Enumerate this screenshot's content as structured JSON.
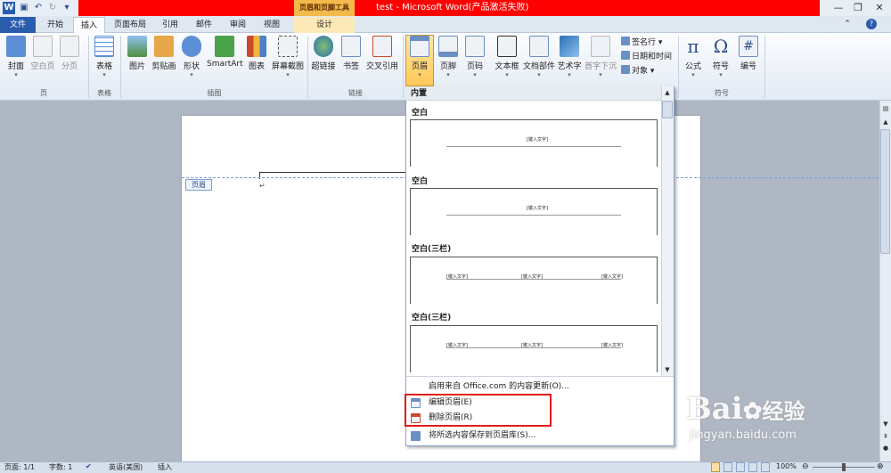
{
  "window": {
    "contextual_group": "页眉和页脚工具",
    "document_title": "test - Microsoft Word(产品激活失败)",
    "controls": [
      "—",
      "❐",
      "✕"
    ],
    "app_icon": "word-icon"
  },
  "tabs": [
    {
      "label": "文件"
    },
    {
      "label": "开始"
    },
    {
      "label": "插入"
    },
    {
      "label": "页面布局"
    },
    {
      "label": "引用"
    },
    {
      "label": "邮件"
    },
    {
      "label": "审阅"
    },
    {
      "label": "视图"
    },
    {
      "label": "设计"
    }
  ],
  "ribbon": {
    "groups": {
      "page": "页",
      "table": "表格",
      "illustrations": "插图",
      "links": "链接",
      "symbols": "符号"
    },
    "buttons": {
      "cover": "封面",
      "blank_page": "空白页",
      "page_break": "分页",
      "table": "表格",
      "picture": "图片",
      "clipart": "剪贴画",
      "shapes": "形状",
      "smartart": "SmartArt",
      "chart": "图表",
      "screenshot": "屏幕截图",
      "hyperlink": "超链接",
      "bookmark": "书签",
      "cross_ref": "交叉引用",
      "header": "页眉",
      "footer": "页脚",
      "page_number": "页码",
      "textbox": "文本框",
      "quick_parts": "文档部件",
      "wordart": "艺术字",
      "dropcap": "首字下沉",
      "signature": "签名行",
      "datetime": "日期和时间",
      "object": "对象",
      "equation": "公式",
      "symbol": "符号",
      "number": "编号",
      "equation_glyph": "π",
      "symbol_glyph": "Ω",
      "number_glyph": "#"
    }
  },
  "document": {
    "header_tag": "页眉",
    "para_mark": "↵"
  },
  "dropdown": {
    "section": "内置",
    "items": [
      {
        "title": "空白",
        "placeholders": [
          "[键入文字]"
        ]
      },
      {
        "title": "空白",
        "placeholders": [
          "[键入文字]"
        ]
      },
      {
        "title": "空白(三栏)",
        "placeholders": [
          "[键入文字]",
          "[键入文字]",
          "[键入文字]"
        ]
      },
      {
        "title": "空白(三栏)",
        "placeholders": [
          "[键入文字]",
          "[键入文字]",
          "[键入文字]"
        ]
      }
    ],
    "menu": {
      "office_update": "启用来自 Office.com 的内容更新(O)...",
      "edit_header": "编辑页眉(E)",
      "remove_header": "删除页眉(R)",
      "save_selection": "将所选内容保存到页眉库(S)..."
    }
  },
  "status": {
    "page": "页面: 1/1",
    "words": "字数: 1",
    "language": "英语(美国)",
    "mode": "插入",
    "zoom": "100%"
  },
  "watermark": {
    "brand": "Bai",
    "brand2": "经验",
    "url": "jingyan.baidu.com"
  },
  "colors": {
    "title_red": "#ff0000",
    "file_tab": "#2a5cae",
    "highlight_box": "#e21c1c"
  }
}
